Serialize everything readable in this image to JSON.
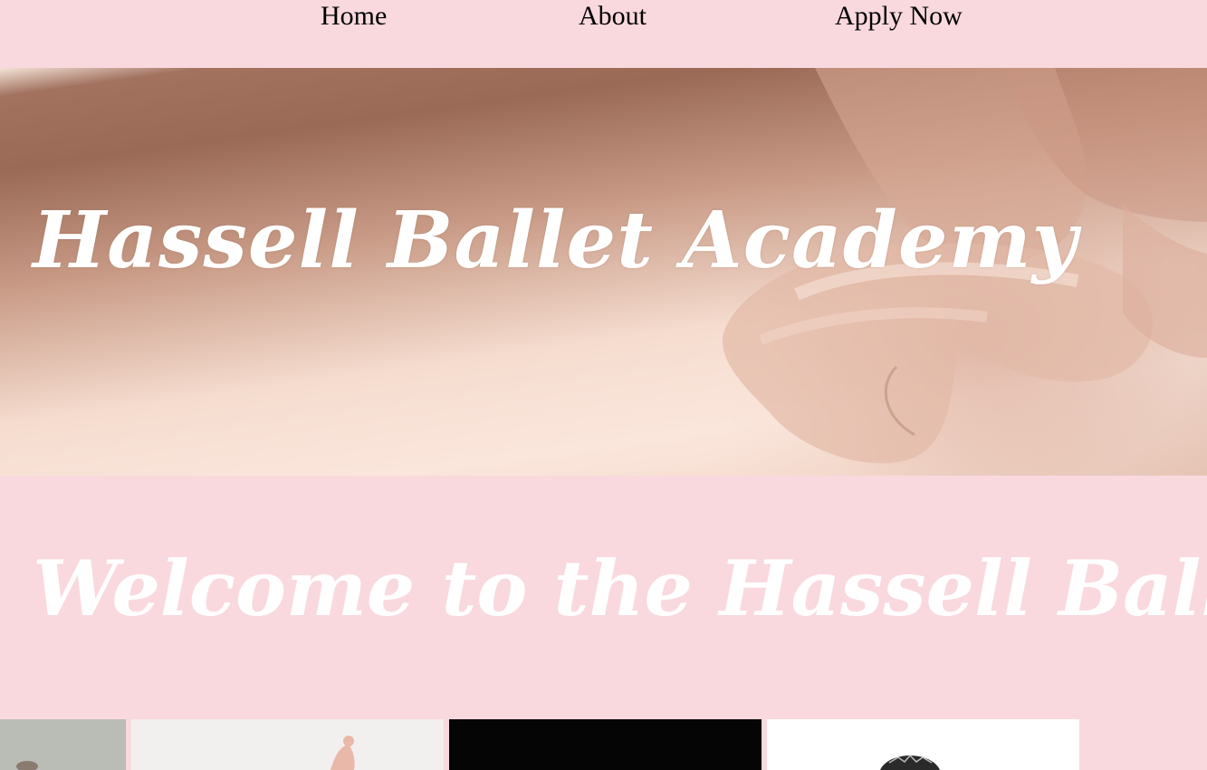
{
  "nav": {
    "items": [
      {
        "label": "Home"
      },
      {
        "label": "About"
      },
      {
        "label": "Apply Now"
      }
    ]
  },
  "hero": {
    "title": "Hassell Ballet Academy"
  },
  "welcome": {
    "text": "Welcome to the Hassell Ballet academy"
  },
  "gallery": {
    "photos": [
      {
        "color": "#b9bdb6"
      },
      {
        "color": "#f2f0ee"
      },
      {
        "color": "#050505"
      },
      {
        "color": "#ffffff"
      }
    ]
  }
}
